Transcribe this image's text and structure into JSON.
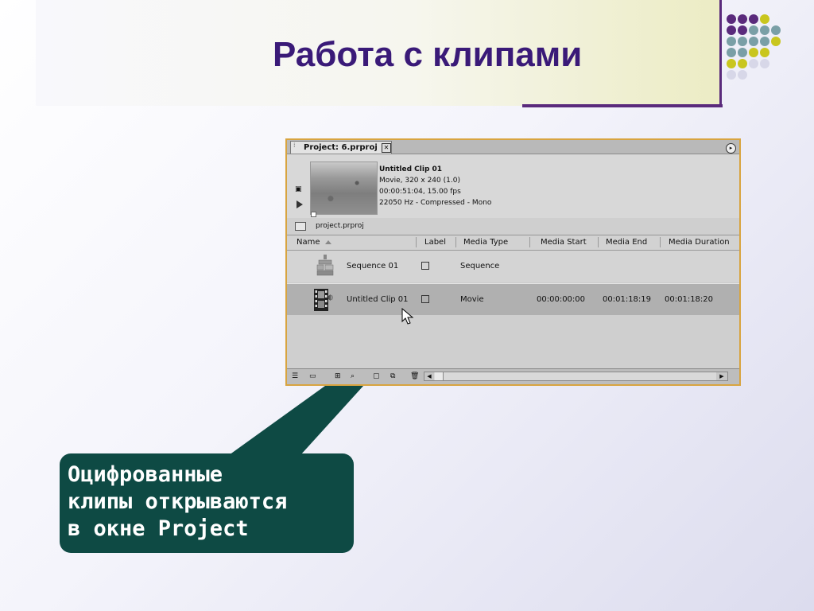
{
  "slide": {
    "title": "Работа с клипами",
    "accent_color": "#3a1a78",
    "decor_colors": [
      "#5a2a7c",
      "#7a9fa6",
      "#c9c61e",
      "#d7d7e8"
    ]
  },
  "project_window": {
    "tab_label": "Project: 6.prproj",
    "close_icon": "close-icon",
    "menu_icon": "panel-menu-icon",
    "preview": {
      "clip_name": "Untitled Clip 01",
      "info_lines": [
        "Movie, 320 x 240 (1.0)",
        "00:00:51:04, 15.00 fps",
        "22050 Hz - Compressed - Mono"
      ]
    },
    "bin": {
      "name": "project.prproj"
    },
    "columns": {
      "name": "Name",
      "label": "Label",
      "media_type": "Media Type",
      "media_start": "Media Start",
      "media_end": "Media End",
      "media_duration": "Media Duration"
    },
    "rows": [
      {
        "name": "Sequence 01",
        "media_type": "Sequence",
        "media_start": "",
        "media_end": "",
        "media_duration": "",
        "icon": "sequence-icon",
        "selected": false
      },
      {
        "name": "Untitled Clip 01",
        "media_type": "Movie",
        "media_start": "00:00:00:00",
        "media_end": "00:01:18:19",
        "media_duration": "00:01:18:20",
        "icon": "movie-clip-icon",
        "selected": true
      }
    ]
  },
  "callout": {
    "lines": [
      "Оцифрованные",
      "клипы открываются",
      "в окне Project"
    ],
    "color": "#0e4a44"
  }
}
